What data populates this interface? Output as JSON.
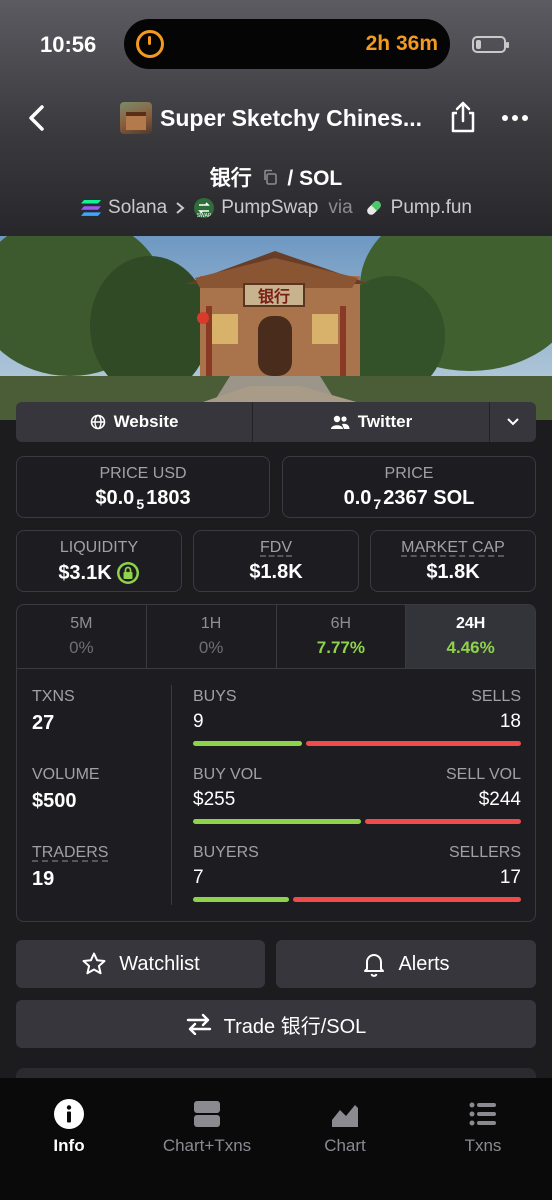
{
  "status_bar": {
    "time": "10:56",
    "timer": "2h 36m"
  },
  "header": {
    "title": "Super Sketchy Chines...",
    "pair_base": "银行",
    "pair_sep": " / ",
    "pair_quote": "SOL",
    "chain": "Solana",
    "dex": "PumpSwap",
    "via": "via",
    "launchpad": "Pump.fun",
    "dex_badge": "SWAP"
  },
  "banner": {
    "sign_text": "银行"
  },
  "links": {
    "website": "Website",
    "twitter": "Twitter"
  },
  "price_usd": {
    "label": "PRICE USD",
    "prefix": "$0.0",
    "zeros": "5",
    "digits": "1803"
  },
  "price_native": {
    "label": "PRICE",
    "prefix": "0.0",
    "zeros": "7",
    "digits": "2367 SOL"
  },
  "liquidity": {
    "label": "LIQUIDITY",
    "value": "$3.1K"
  },
  "fdv": {
    "label": "FDV",
    "value": "$1.8K"
  },
  "market_cap": {
    "label": "MARKET CAP",
    "value": "$1.8K"
  },
  "timeframes": [
    {
      "label": "5M",
      "change": "0%"
    },
    {
      "label": "1H",
      "change": "0%"
    },
    {
      "label": "6H",
      "change": "7.77%"
    },
    {
      "label": "24H",
      "change": "4.46%"
    }
  ],
  "stats": {
    "txns": {
      "label": "TXNS",
      "value": "27"
    },
    "volume": {
      "label": "VOLUME",
      "value": "$500"
    },
    "traders": {
      "label": "TRADERS",
      "value": "19"
    },
    "buys": {
      "label": "BUYS",
      "value": "9"
    },
    "sells": {
      "label": "SELLS",
      "value": "18"
    },
    "buy_vol": {
      "label": "BUY VOL",
      "value": "$255"
    },
    "sell_vol": {
      "label": "SELL VOL",
      "value": "$244"
    },
    "buyers": {
      "label": "BUYERS",
      "value": "7"
    },
    "sellers": {
      "label": "SELLERS",
      "value": "17"
    },
    "buys_share": 0.333,
    "buy_vol_share": 0.511,
    "buyers_share": 0.292
  },
  "actions": {
    "watchlist": "Watchlist",
    "alerts": "Alerts",
    "trade": "Trade 银行/SOL"
  },
  "tabbar": {
    "info": "Info",
    "chart_txns": "Chart+Txns",
    "chart": "Chart",
    "txns": "Txns"
  },
  "colors": {
    "green": "#8fd34a",
    "red": "#ef4b4b",
    "accent_orange": "#f39a1f"
  }
}
